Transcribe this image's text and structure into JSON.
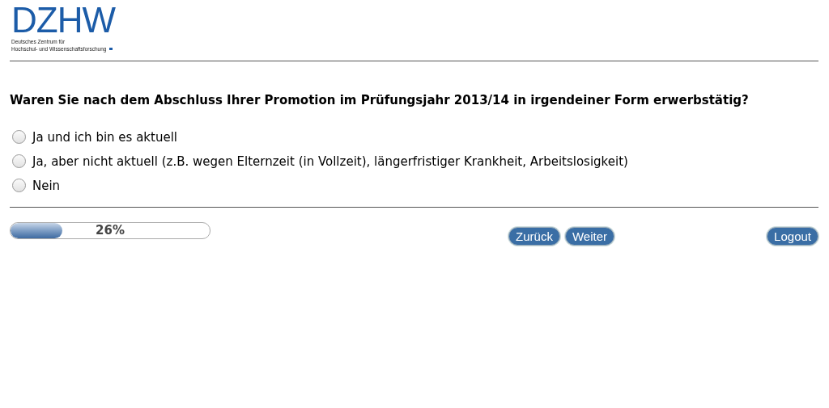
{
  "logo": {
    "wordmark": "DZHW",
    "subtitle_lines": [
      "Deutsches Zentrum für",
      "Hochschul- und Wissenschaftsforschung"
    ]
  },
  "question": "Waren Sie nach dem Abschluss Ihrer Promotion im Prüfungsjahr 2013/14 in irgendeiner Form erwerbstätig?",
  "options": [
    {
      "label": "Ja und ich bin es aktuell",
      "selected": false
    },
    {
      "label": "Ja, aber nicht aktuell (z.B. wegen Elternzeit (in Vollzeit), längerfristiger Krankheit, Arbeitslosigkeit)",
      "selected": false
    },
    {
      "label": "Nein",
      "selected": false
    }
  ],
  "progress": {
    "level": 0.26,
    "reading": "26%"
  },
  "nav_buttons": [
    "Zurück",
    "Weiter"
  ],
  "logout_button": "Logout"
}
